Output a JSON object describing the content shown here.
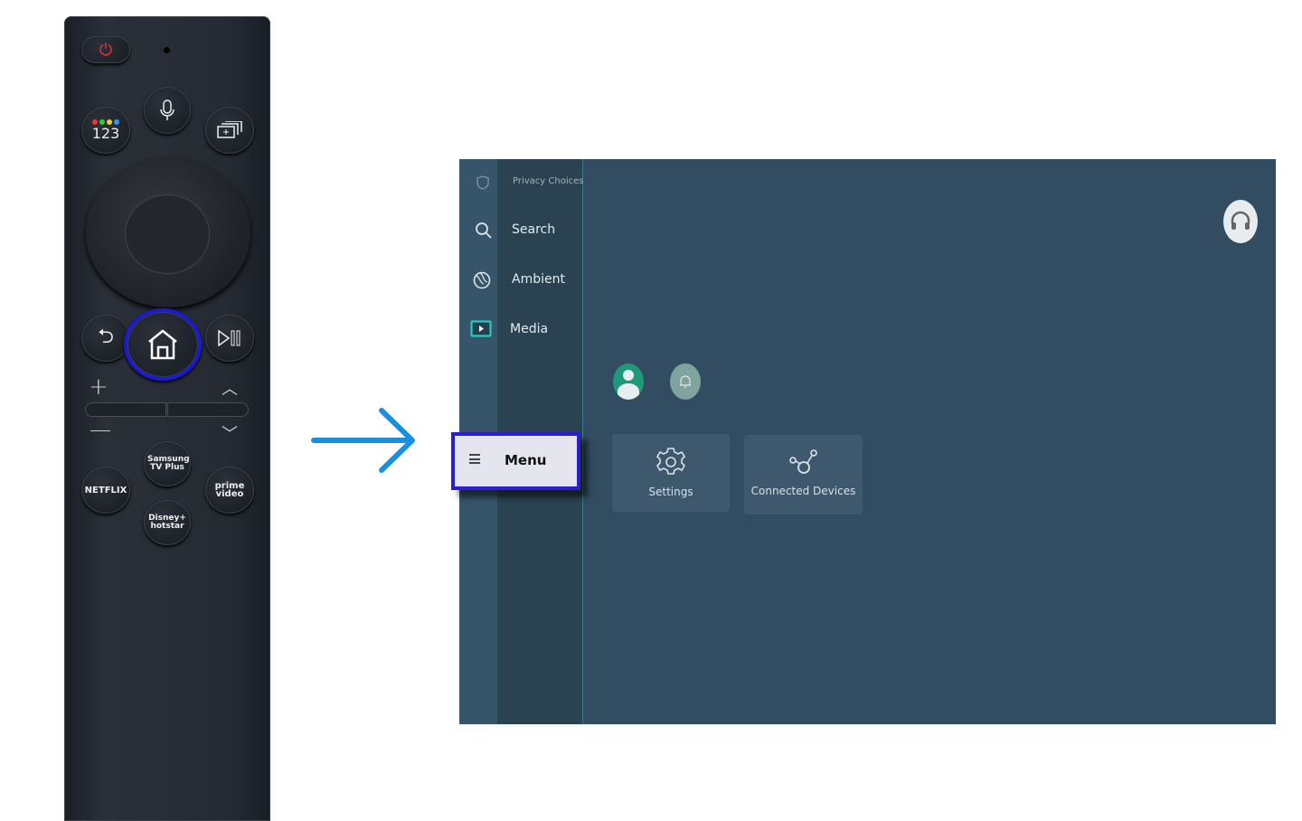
{
  "remote": {
    "buttons": {
      "color_keys": "123",
      "samsung_tv_plus": "Samsung TV Plus",
      "netflix": "NETFLIX",
      "prime_video": "prime video",
      "disney_hotstar": "Disney+ hotstar"
    },
    "highlight_color": "#1a1ad0"
  },
  "arrow_color": "#1a8fe0",
  "tv": {
    "sidebar": {
      "items": [
        {
          "label": "Privacy Choices",
          "icon": "shield-icon"
        },
        {
          "label": "Search",
          "icon": "search-icon"
        },
        {
          "label": "Ambient",
          "icon": "ambient-icon"
        },
        {
          "label": "Media",
          "icon": "media-icon"
        }
      ],
      "menu": {
        "label": "Menu",
        "icon": "hamburger-icon"
      }
    },
    "tiles": [
      {
        "label": "Settings",
        "icon": "gear-icon"
      },
      {
        "label": "Connected Devices",
        "icon": "connected-devices-icon"
      }
    ]
  }
}
